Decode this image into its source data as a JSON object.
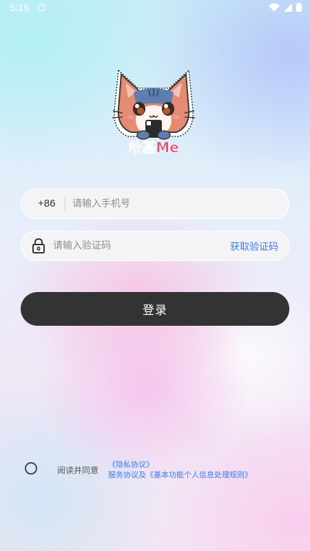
{
  "status_bar": {
    "time": "5:19"
  },
  "logo": {
    "text": "哈基Me"
  },
  "login_form": {
    "country_code": "+86",
    "phone_placeholder": "请输入手机号",
    "code_placeholder": "请输入验证码",
    "get_code_label": "获取验证码",
    "login_label": "登录"
  },
  "agreement": {
    "agree_text": "阅读并同意",
    "privacy_link": "《隐私协议》",
    "service_link": "服务协议及《基本功能个人信息处理规则》"
  },
  "colors": {
    "accent": "#3a7de6",
    "button": "#333333",
    "logo_text": "#e0536f"
  }
}
